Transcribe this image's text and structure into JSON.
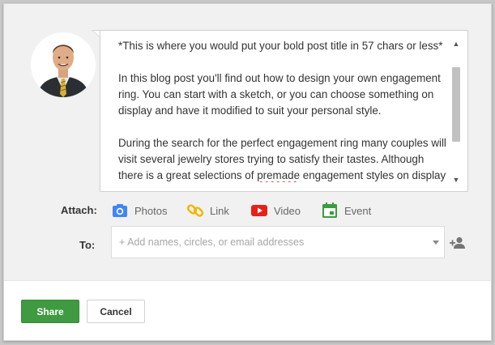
{
  "post": {
    "paragraphs": [
      "*This is where you would put your bold post title in 57 chars or less*",
      "In this blog post you'll find out how to design your own engagement ring.  You can start with a sketch, or you can choose something on display and have it modified to suit your personal style."
    ],
    "p3_before": "During the search for the perfect engagement ring many couples will visit several jewelry stores trying to satisfy their tastes. Although there is a great selections of ",
    "p3_misspelled": "premade",
    "p3_after": " engagement styles on display here at our store, most of our couples prefer to design something"
  },
  "attach": {
    "label": "Attach:",
    "items": [
      {
        "label": "Photos",
        "icon": "camera-icon",
        "color": "#4285f4"
      },
      {
        "label": "Link",
        "icon": "link-icon",
        "color": "#f4b400"
      },
      {
        "label": "Video",
        "icon": "youtube-icon",
        "color": "#e62117"
      },
      {
        "label": "Event",
        "icon": "calendar-icon",
        "color": "#3c9b3f"
      }
    ]
  },
  "to": {
    "label": "To:",
    "placeholder": "+ Add names, circles, or email addresses"
  },
  "buttons": {
    "share": "Share",
    "cancel": "Cancel"
  },
  "colors": {
    "share_bg": "#3f9a41",
    "panel_bg": "#f1f1f1"
  }
}
